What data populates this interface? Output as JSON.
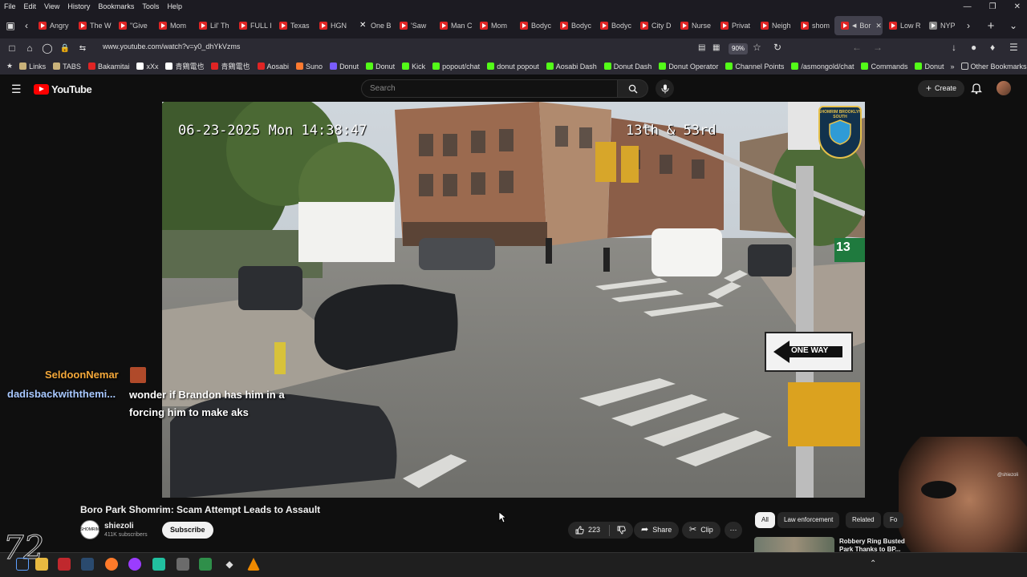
{
  "browser": {
    "menu": [
      "File",
      "Edit",
      "View",
      "History",
      "Bookmarks",
      "Tools",
      "Help"
    ],
    "tabs": [
      {
        "label": "Angry",
        "kind": "yt"
      },
      {
        "label": "The W",
        "kind": "yt"
      },
      {
        "label": "\"Give",
        "kind": "yt"
      },
      {
        "label": "Mom",
        "kind": "yt"
      },
      {
        "label": "Lil' Th",
        "kind": "yt"
      },
      {
        "label": "FULL I",
        "kind": "yt"
      },
      {
        "label": "Texas",
        "kind": "yt"
      },
      {
        "label": "HGN",
        "kind": "yt"
      },
      {
        "label": "One B",
        "kind": "x"
      },
      {
        "label": "'Saw",
        "kind": "yt"
      },
      {
        "label": "Man C",
        "kind": "yt"
      },
      {
        "label": "Mom",
        "kind": "yt"
      },
      {
        "label": "Bodyc",
        "kind": "yt"
      },
      {
        "label": "Bodyc",
        "kind": "yt"
      },
      {
        "label": "Bodyc",
        "kind": "yt"
      },
      {
        "label": "City D",
        "kind": "yt"
      },
      {
        "label": "Nurse",
        "kind": "yt"
      },
      {
        "label": "Privat",
        "kind": "yt"
      },
      {
        "label": "Neigh",
        "kind": "yt"
      },
      {
        "label": "shom",
        "kind": "yt"
      },
      {
        "label": "Bor",
        "kind": "yt",
        "active": true
      },
      {
        "label": "Low R",
        "kind": "yt"
      },
      {
        "label": "NYP",
        "kind": "doc"
      }
    ],
    "url": "www.youtube.com/watch?v=y0_dhYkVzms",
    "zoom": "90%",
    "bookmarks": [
      {
        "label": "Links",
        "color": "#c9b27a"
      },
      {
        "label": "TABS",
        "color": "#c9b27a"
      },
      {
        "label": "Bakamitai",
        "color": "#e02424"
      },
      {
        "label": "xXx",
        "color": "#ffffff"
      },
      {
        "label": "青鶏電也",
        "color": "#ffffff"
      },
      {
        "label": "青鶏電也",
        "color": "#e02424"
      },
      {
        "label": "Aosabi",
        "color": "#e02424"
      },
      {
        "label": "Suno",
        "color": "#ff7a30"
      },
      {
        "label": "Donut",
        "color": "#7a5cff"
      },
      {
        "label": "Donut",
        "color": "#53fc18"
      },
      {
        "label": "Kick",
        "color": "#53fc18"
      },
      {
        "label": "popout/chat",
        "color": "#53fc18"
      },
      {
        "label": "donut popout",
        "color": "#53fc18"
      },
      {
        "label": "Aosabi Dash",
        "color": "#53fc18"
      },
      {
        "label": "Donut Dash",
        "color": "#53fc18"
      },
      {
        "label": "Donut Operator",
        "color": "#53fc18"
      },
      {
        "label": "Channel Points",
        "color": "#53fc18"
      },
      {
        "label": "/asmongold/chat",
        "color": "#53fc18"
      },
      {
        "label": "Commands",
        "color": "#53fc18"
      },
      {
        "label": "Donut",
        "color": "#53fc18"
      }
    ],
    "other_bookmarks": "Other Bookmarks"
  },
  "youtube": {
    "logo": "YouTube",
    "search_placeholder": "Search",
    "create_label": "Create"
  },
  "video": {
    "timestamp": "06-23-2025 Mon 14:38:47",
    "location": "13th & 53rd",
    "street_sign": "ONE WAY",
    "street_number": "13",
    "badge": "SHOMRIM BROOKLYN SOUTH"
  },
  "chat": {
    "name1": "SeldoonNemar",
    "name2": "dadisbackwiththemi...",
    "message_line1": "wonder if Brandon has him in a",
    "message_line2": "forcing him to make aks"
  },
  "info": {
    "title": "Boro Park Shomrim: Scam Attempt Leads to Assault",
    "channel": "shiezoli",
    "subscribers": "411K subscribers",
    "subscribe": "Subscribe",
    "likes": "223",
    "share": "Share",
    "clip": "Clip"
  },
  "sidebar": {
    "chips": [
      "All",
      "Law enforcement",
      "Related",
      "Fo"
    ],
    "related_title": "Robbery Ring Busted Park Thanks to BP..."
  },
  "overlay": {
    "logo_text": "72",
    "watermark": "@shiezoli"
  }
}
